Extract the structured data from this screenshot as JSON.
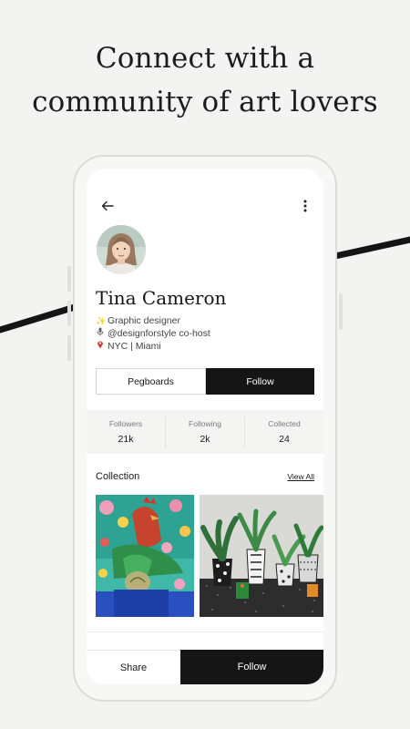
{
  "headline": {
    "line1": "Connect with a",
    "line2": "community of art lovers"
  },
  "profile": {
    "name": "Tina Cameron",
    "bio": [
      {
        "icon": "sparkles-icon",
        "text": "Graphic designer"
      },
      {
        "icon": "microphone-icon",
        "text": "@designforstyle co-host"
      },
      {
        "icon": "pin-icon",
        "text": "NYC | Miami"
      }
    ]
  },
  "actions": {
    "pegboards_label": "Pegboards",
    "follow_label": "Follow"
  },
  "stats": [
    {
      "label": "Followers",
      "value": "21k"
    },
    {
      "label": "Following",
      "value": "2k"
    },
    {
      "label": "Collected",
      "value": "24"
    }
  ],
  "collection": {
    "title": "Collection",
    "view_all": "View All"
  },
  "bottom_bar": {
    "share_label": "Share",
    "follow_label": "Follow"
  },
  "colors": {
    "accent": "#151515",
    "background": "#f3f3f1"
  }
}
